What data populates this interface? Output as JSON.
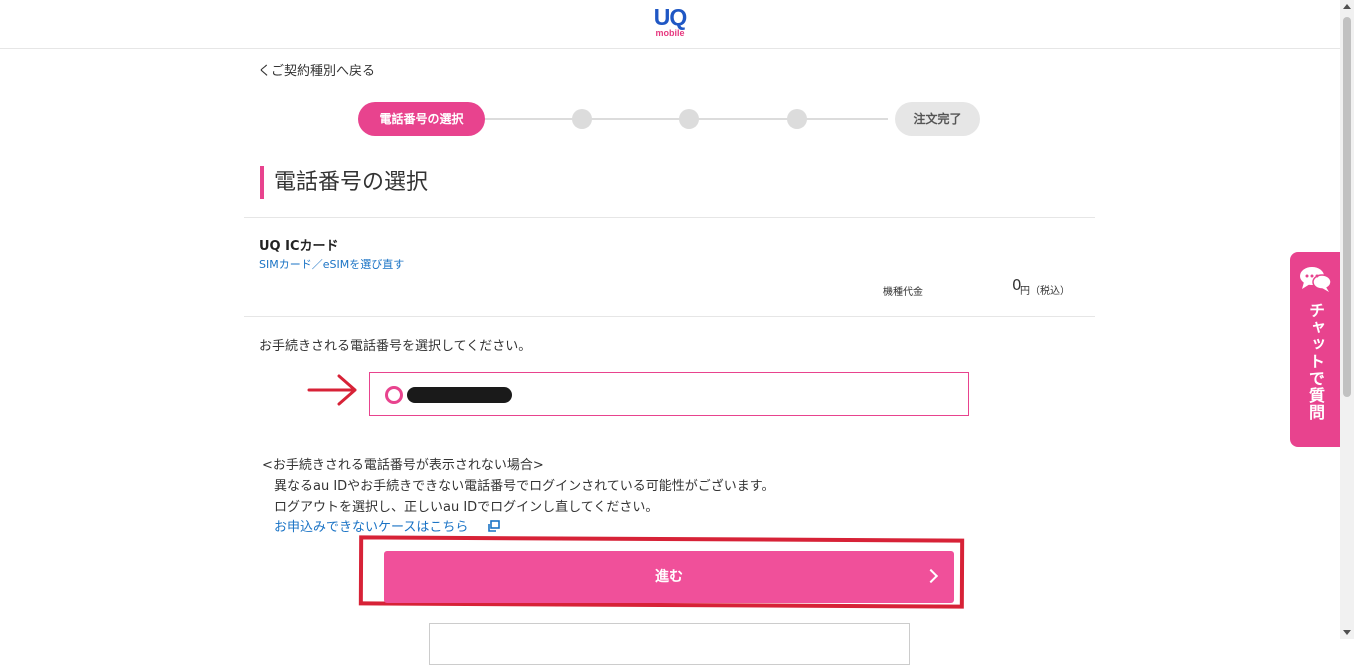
{
  "header": {
    "logo_text": "UQ",
    "logo_sub": "mobile"
  },
  "nav": {
    "back_link": "くご契約種別へ戻る"
  },
  "stepper": {
    "active_step": "電話番号の選択",
    "final_step": "注文完了",
    "current_step_index": 1,
    "total_steps": 5
  },
  "main": {
    "page_title": "電話番号の選択",
    "sim": {
      "title": "UQ ICカード",
      "change_link": "SIMカード／eSIMを選び直す",
      "price_label": "機種代金",
      "price_value": "0",
      "price_unit": "円（税込）"
    },
    "select_prompt": "お手続きされる電話番号を選択してください。",
    "notice": {
      "heading": "<お手続きされる電話番号が表示されない場合>",
      "line1": "異なるau IDやお手続きできない電話番号でログインされている可能性がございます。",
      "line2": "ログアウトを選択し、正しいau IDでログインし直してください。",
      "link": "お申込みできないケースはこちら"
    },
    "proceed_button": "進む"
  },
  "chat": {
    "label": "チャットで質問"
  },
  "colors": {
    "brand_pink": "#e8438e",
    "button_pink": "#f0509a",
    "link_blue": "#1a73c5",
    "annotation_red": "#d72237",
    "logo_blue": "#1f57c4"
  }
}
